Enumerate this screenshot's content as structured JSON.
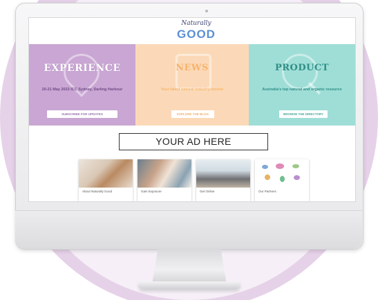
{
  "screen": {
    "logo": {
      "top": "Naturally",
      "bottom": "GOOD"
    },
    "panels": {
      "experience": {
        "title": "EXPERIENCE",
        "subtitle": "20-21 May 2023 ICC Sydney, Darling Harbour",
        "button": "SUBSCRIBE FOR UPDATES"
      },
      "news": {
        "title": "NEWS",
        "subtitle": "Your latest natural industry stories",
        "button": "EXPLORE THE BLOG"
      },
      "product": {
        "title": "PRODUCT",
        "subtitle": "Australia's top natural and organic resource",
        "button": "BROWSE THE DIRECTORY"
      }
    },
    "ad": {
      "label": "YOUR AD HERE"
    },
    "cards": [
      {
        "label": "About Naturally Good"
      },
      {
        "label": "Gain Exposure"
      },
      {
        "label": "Get Online"
      },
      {
        "label": "Our Partners"
      }
    ]
  },
  "colors": {
    "experience": "#c9a6d3",
    "news": "#fbd9b8",
    "product": "#9fded7",
    "background_circle": "#e6d2e8"
  },
  "icons": {
    "experience": "map-pin-icon",
    "news": "newspaper-icon",
    "product": "magnifier-icon"
  }
}
